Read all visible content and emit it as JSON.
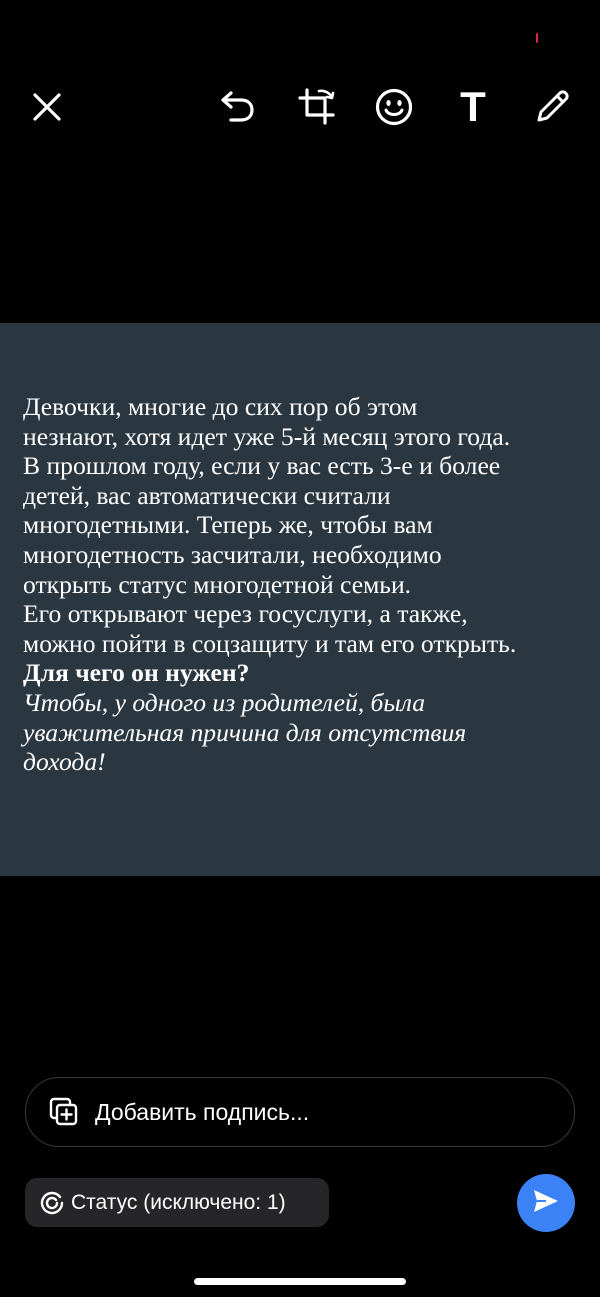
{
  "colors": {
    "background": "#000000",
    "image_background": "#2b3740",
    "accent_blue": "#3b82f6",
    "pill_background": "#262628",
    "indicator_red": "#e0243a"
  },
  "toolbar": {
    "icons": [
      "close-icon",
      "undo-icon",
      "crop-rotate-icon",
      "emoji-icon",
      "text-tool-icon",
      "pencil-icon"
    ],
    "text_tool_glyph": "T"
  },
  "post": {
    "body": "Девочки, многие до сих пор об этом\nнезнают, хотя идет уже 5-й месяц этого года.\nВ прошлом году, если у вас есть 3-е и более\nдетей, вас автоматически считали\nмногодетными. Теперь же, чтобы вам\nмногодетность засчитали, необходимо\nоткрыть статус многодетной семьи.\nЕго открывают через госуслуги, а также,\nможно пойти в соцзащиту и там его открыть.",
    "heading": "Для чего он нужен?",
    "italic": "Чтобы, у одного из родителей, была\nуважительная причина для отсутствия\nдохода!"
  },
  "caption": {
    "placeholder": "Добавить подпись...",
    "icon": "add-media-icon"
  },
  "status_pill": {
    "label": "Статус (исключено: 1)",
    "icon": "status-ring-icon"
  },
  "send": {
    "icon": "send-icon"
  }
}
